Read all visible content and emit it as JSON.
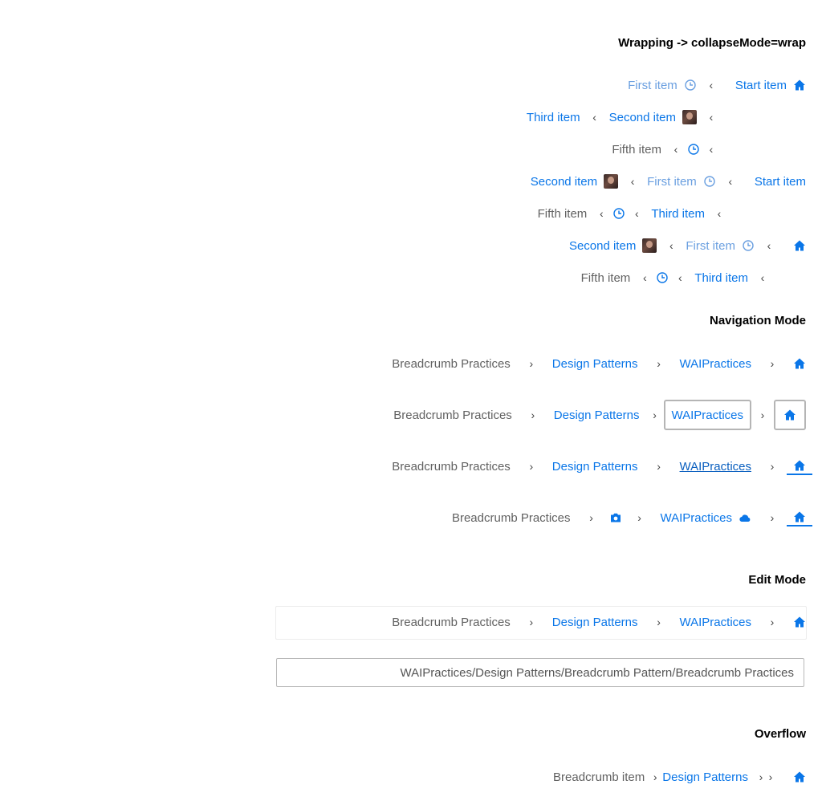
{
  "headings": {
    "wrapping": "Wrapping -> collapseMode=wrap",
    "navigation": "Navigation Mode",
    "edit": "Edit Mode",
    "overflow": "Overflow"
  },
  "items": {
    "start": "Start item",
    "first": "First item",
    "second": "Second item",
    "third": "Third item",
    "fifth": "Fifth item"
  },
  "crumbs": {
    "practices": "Breadcrumb Practices",
    "patterns": "Design Patterns",
    "wai": "WAIPractices",
    "item": "Breadcrumb item"
  },
  "edit": {
    "path_value": "WAIPractices/Design Patterns/Breadcrumb Pattern/Breadcrumb Practices"
  },
  "separators": {
    "wrap": "‹",
    "nav": "›"
  },
  "icons": [
    "home-icon",
    "clock-icon",
    "avatar-image",
    "camera-icon",
    "cloud-icon"
  ],
  "colors": {
    "link": "#0a76e8",
    "muted_link": "#6a9fe0",
    "current": "#616161",
    "focus_border": "#b5b5b5"
  }
}
